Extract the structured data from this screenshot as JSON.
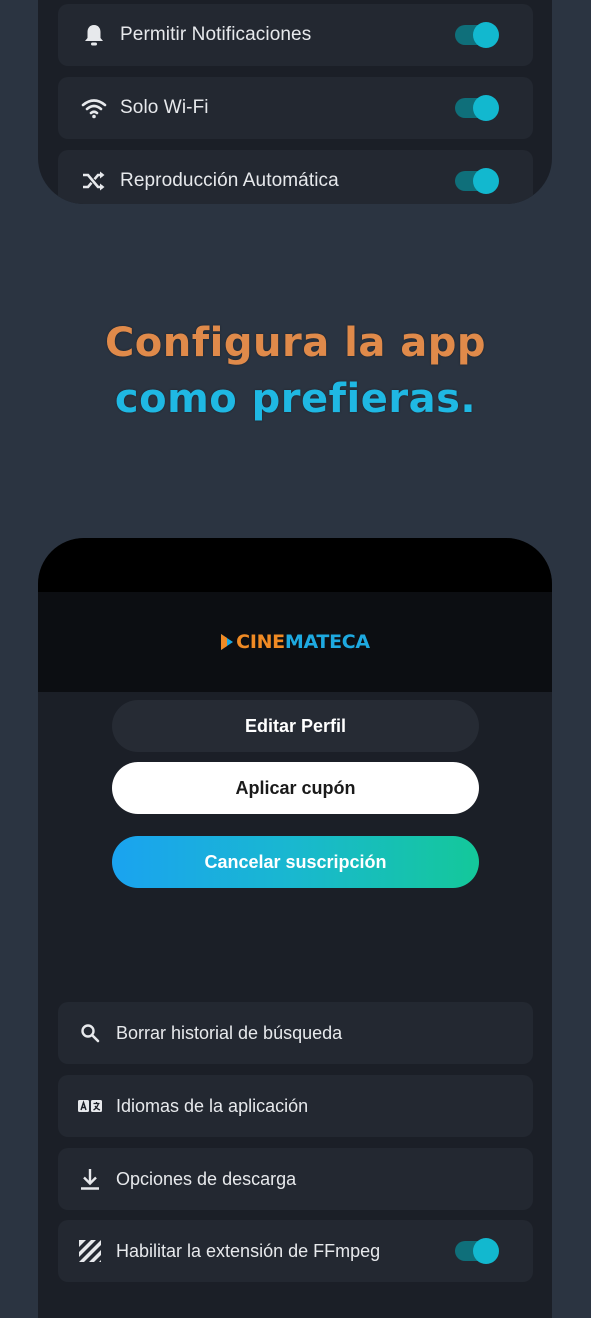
{
  "top_settings": [
    {
      "label": "Permitir Notificaciones",
      "icon": "bell-icon",
      "enabled": true
    },
    {
      "label": "Solo Wi-Fi",
      "icon": "wifi-icon",
      "enabled": true
    },
    {
      "label": "Reproducción Automática",
      "icon": "shuffle-icon",
      "enabled": true
    }
  ],
  "headline": {
    "line1": "Configura la app",
    "line2": "como prefieras."
  },
  "app": {
    "logo_left": "CINE",
    "logo_right": "MATECA"
  },
  "buttons": {
    "edit_profile": "Editar Perfil",
    "apply_coupon": "Aplicar cupón",
    "cancel_subscription": "Cancelar suscripción"
  },
  "options": [
    {
      "label": "Borrar historial de búsqueda",
      "icon": "search-icon"
    },
    {
      "label": "Idiomas de la aplicación",
      "icon": "translate-icon"
    },
    {
      "label": "Opciones de descarga",
      "icon": "download-icon"
    },
    {
      "label": "Habilitar la extensión de FFmpeg",
      "icon": "ffmpeg-icon",
      "enabled": true
    }
  ],
  "colors": {
    "background": "#2b3441",
    "phone": "#1b1f27",
    "row": "#232831",
    "toggle_accent": "#12b8cf",
    "headline_orange": "#e08a4a",
    "headline_blue": "#1fb8e3",
    "gradient_start": "#1aa3f0",
    "gradient_end": "#14c89a"
  }
}
